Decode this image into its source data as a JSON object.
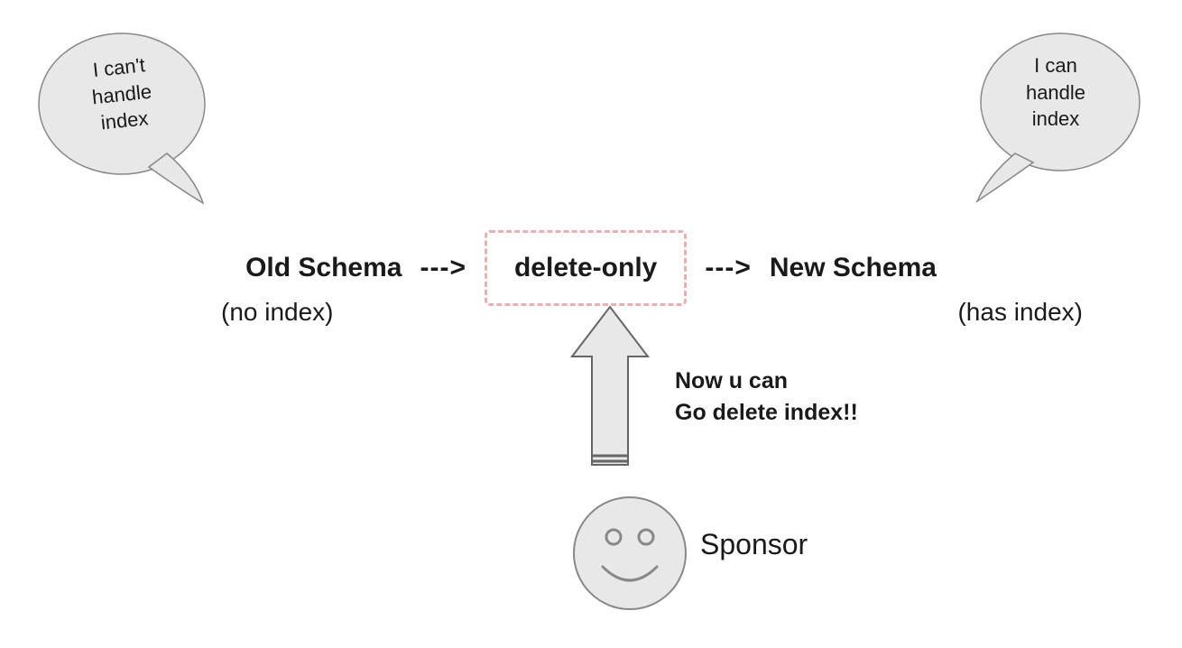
{
  "bubbles": {
    "left": "I can't\nhandle\nindex",
    "right": "I can\nhandle\nindex"
  },
  "flow": {
    "old_schema": "Old Schema",
    "arrow1": "--->",
    "delete_only": "delete-only",
    "arrow2": "--->",
    "new_schema": "New Schema"
  },
  "subtexts": {
    "no_index": "(no index)",
    "has_index": "(has index)"
  },
  "sponsor": {
    "message_line1": "Now u can",
    "message_line2": "Go delete index!!",
    "label": "Sponsor"
  },
  "colors": {
    "bubble_fill": "#e8e8e8",
    "bubble_stroke": "#888888",
    "dashed_border": "#e8b0b0",
    "text": "#1a1a1a"
  }
}
